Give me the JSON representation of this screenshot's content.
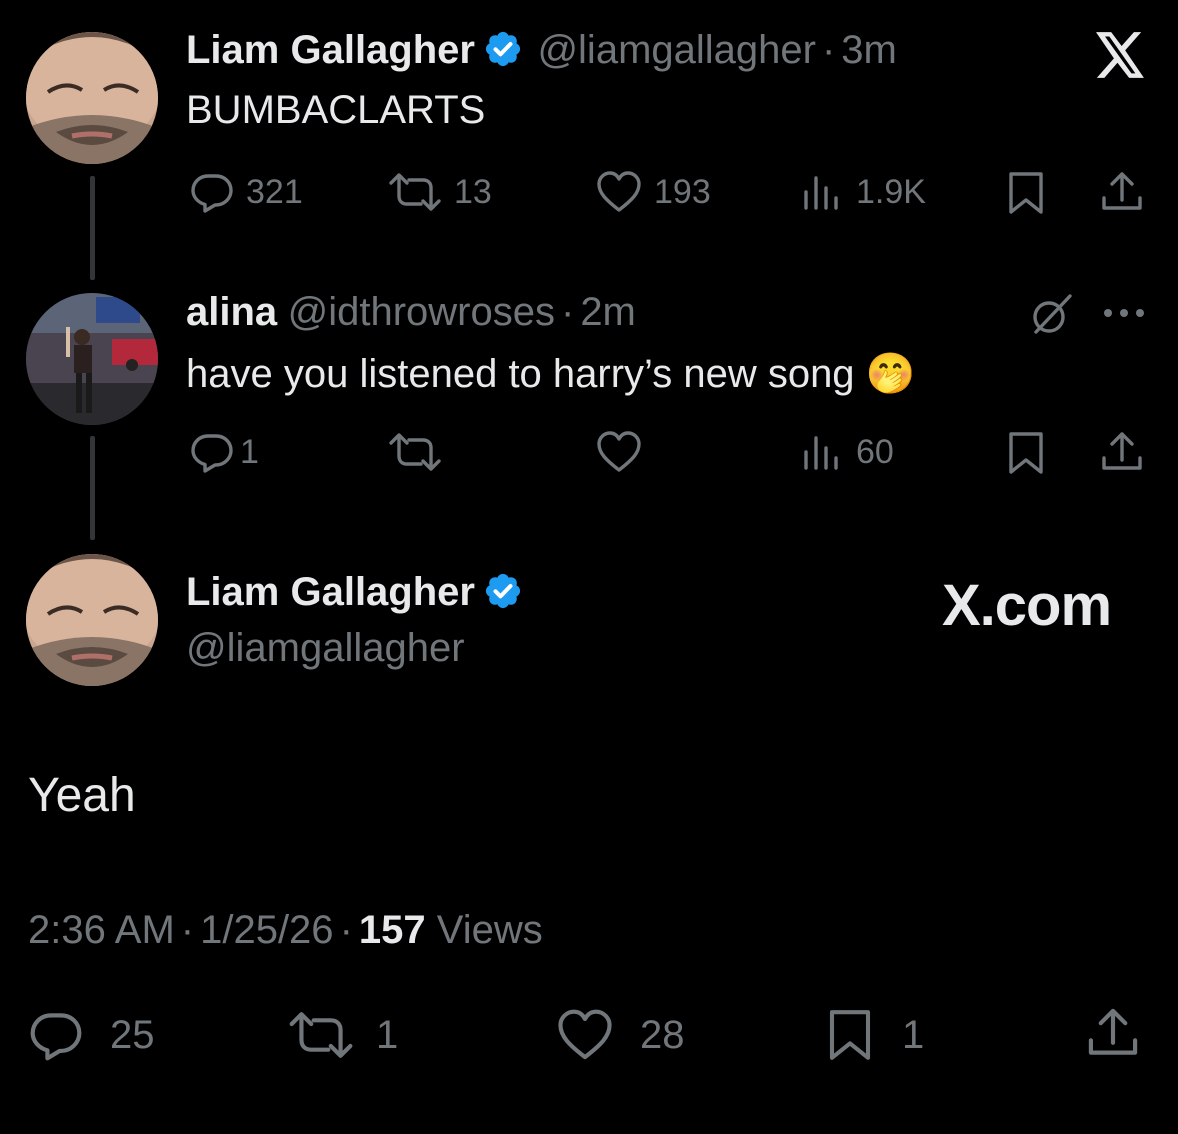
{
  "tweets": [
    {
      "name": "Liam Gallagher",
      "handle": "@liamgallagher",
      "sep": "·",
      "time": "3m",
      "text": "BUMBACLARTS",
      "stats": {
        "replies": "321",
        "reposts": "13",
        "likes": "193",
        "views": "1.9K"
      }
    },
    {
      "name": "alina",
      "handle": "@idthrowroses",
      "sep": "·",
      "time": "2m",
      "text": "have you listened to harry’s new song",
      "emoji": "🤭",
      "stats": {
        "replies": "1",
        "views": "60"
      }
    }
  ],
  "main": {
    "name": "Liam Gallagher",
    "handle": "@liamgallagher",
    "text": "Yeah",
    "time": "2:36 AM",
    "date": "1/25/26",
    "sep": "·",
    "views_count": "157",
    "views_label": "Views",
    "stats": {
      "replies": "25",
      "reposts": "1",
      "likes": "28",
      "bookmarks": "1"
    }
  },
  "brand": {
    "logo": "𝕏",
    "site": "X.com"
  },
  "colors": {
    "background": "#000000",
    "text": "#e7e9ea",
    "secondary": "#71767b",
    "verified": "#1d9bf0"
  }
}
